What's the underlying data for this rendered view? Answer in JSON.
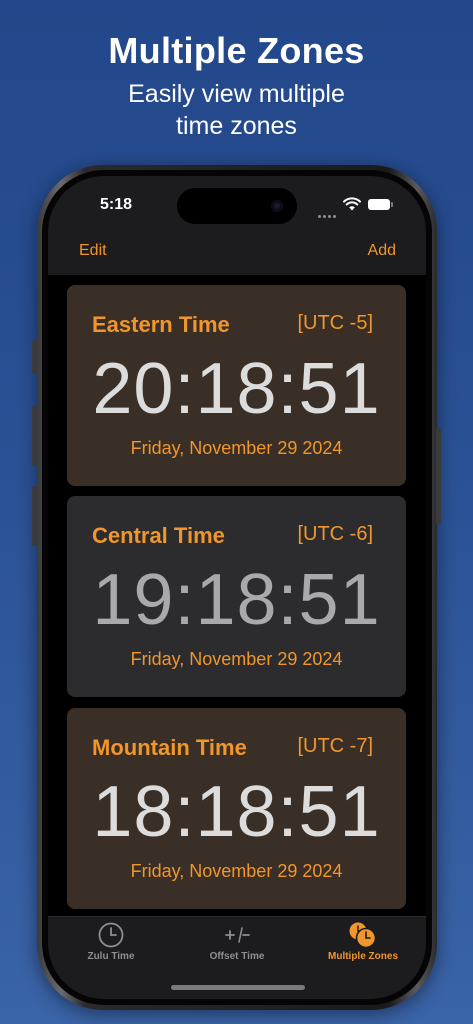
{
  "promo": {
    "headline": "Multiple Zones",
    "subline_1": "Easily view multiple",
    "subline_2": "time zones"
  },
  "status_bar": {
    "time": "5:18",
    "icons": [
      "signal-dots-icon",
      "wifi-icon",
      "battery-icon"
    ]
  },
  "nav": {
    "edit_label": "Edit",
    "add_label": "Add"
  },
  "zones": [
    {
      "name": "Eastern Time",
      "utc": "[UTC -5]",
      "time": "20:18:51",
      "date": "Friday, November 29 2024",
      "card_color": "#3a2f26",
      "time_color": "#dcdcdc"
    },
    {
      "name": "Central Time",
      "utc": "[UTC -6]",
      "time": "19:18:51",
      "date": "Friday, November 29 2024",
      "card_color": "#2c2c2e",
      "time_color": "#a9a9ab"
    },
    {
      "name": "Mountain Time",
      "utc": "[UTC -7]",
      "time": "18:18:51",
      "date": "Friday, November 29 2024",
      "card_color": "#3a2f26",
      "time_color": "#dcdcdc"
    }
  ],
  "tabs": [
    {
      "label": "Zulu Time",
      "icon": "clock-icon",
      "active": false
    },
    {
      "label": "Offset Time",
      "icon": "plus-minus-icon",
      "active": false
    },
    {
      "label": "Multiple Zones",
      "icon": "multiple-clocks-icon",
      "active": true
    }
  ],
  "colors": {
    "accent": "#f0962c",
    "background_top": "#22478a",
    "background_bottom": "#3a64a8",
    "inactive_tab": "#8e8e93"
  }
}
